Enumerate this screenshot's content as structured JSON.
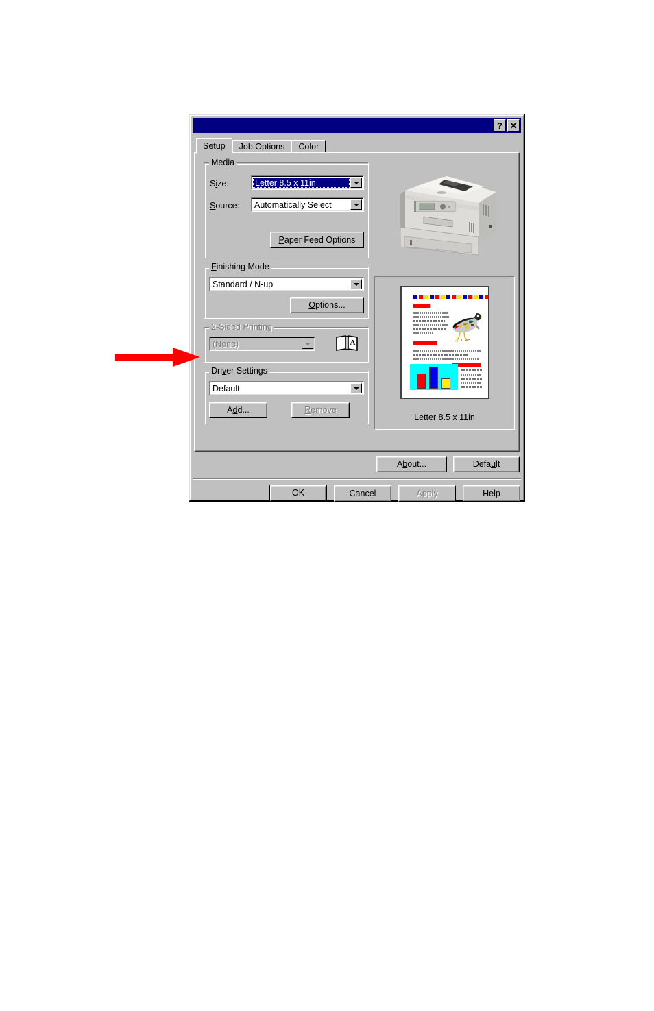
{
  "window": {
    "title": "",
    "titlebar_color": "#000080",
    "face_color": "#c0c0c0",
    "buttons": [
      {
        "name": "help",
        "glyph": "?"
      },
      {
        "name": "close",
        "glyph": "✕"
      }
    ]
  },
  "tabs": [
    {
      "label": "Setup",
      "active": true
    },
    {
      "label": "Job Options",
      "active": false
    },
    {
      "label": "Color",
      "active": false
    }
  ],
  "setup_tab": {
    "media": {
      "group_label": "Media",
      "size_label": "Size:",
      "size_value": "Letter 8.5 x 11in",
      "size_selected": true,
      "source_label": "Source:",
      "source_value": "Automatically Select",
      "paper_feed_button": "Paper Feed Options"
    },
    "finishing": {
      "group_label": "Finishing Mode",
      "value": "Standard / N-up",
      "options_button": "Options..."
    },
    "two_sided": {
      "group_label": "2-Sided Printing",
      "value": "(None)",
      "disabled": true,
      "book_icon_letter": "A"
    },
    "driver_settings": {
      "group_label": "Driver Settings",
      "value": "Default",
      "add_button": "Add...",
      "remove_button": "Remove",
      "remove_disabled": true
    },
    "preview": {
      "caption": "Letter 8.5 x 11in"
    },
    "about_button": "About...",
    "default_button": "Default"
  },
  "dialog_buttons": [
    {
      "label": "OK",
      "default": true,
      "disabled": false
    },
    {
      "label": "Cancel",
      "default": false,
      "disabled": false
    },
    {
      "label": "Apply",
      "default": false,
      "disabled": true
    },
    {
      "label": "Help",
      "default": false,
      "disabled": false
    }
  ],
  "annotation": {
    "arrow_color": "#ff0000",
    "points_to": "2-Sided Printing"
  },
  "thumbnail": {
    "color_squares": [
      "#0000cc",
      "#ff0000",
      "#ffdd00",
      "#0000cc",
      "#ff0000",
      "#ffdd00",
      "#0000cc",
      "#ff0000",
      "#ffdd00",
      "#0000cc",
      "#ff0000",
      "#ffdd00",
      "#0000cc",
      "#ff0000"
    ],
    "chart_bg": "#00ffff",
    "chart_bars": [
      {
        "color": "#ff0000",
        "height_pct": 62
      },
      {
        "color": "#0000ee",
        "height_pct": 88
      },
      {
        "color": "#ffee00",
        "height_pct": 42
      }
    ]
  }
}
